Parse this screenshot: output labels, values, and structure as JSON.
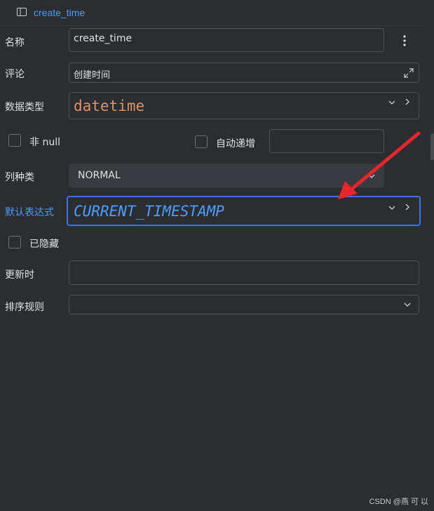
{
  "header": {
    "title": "create_time"
  },
  "labels": {
    "name": "名称",
    "comment": "评论",
    "data_type": "数据类型",
    "column_kind": "列种类",
    "default_expr": "默认表达式",
    "on_update": "更新时",
    "collation": "排序规则"
  },
  "fields": {
    "name_value": "create_time",
    "comment_value": "创建时间",
    "data_type_value": "datetime",
    "column_kind_value": "NORMAL",
    "default_expr_value": "CURRENT_TIMESTAMP",
    "auto_inc_value": "",
    "on_update_value": "",
    "collation_value": ""
  },
  "checkboxes": {
    "not_null": {
      "label": "非 null",
      "checked": false
    },
    "auto_increment": {
      "label": "自动递增",
      "checked": false
    },
    "hidden": {
      "label": "已隐藏",
      "checked": false
    }
  },
  "colors": {
    "background": "#2b2d30",
    "accent": "#4a9eff",
    "data_type_text": "#d7956d",
    "focus_border": "#3574f0",
    "annotation_arrow": "#e5262b"
  },
  "icons": {
    "header": "panel-icon",
    "more": "more-vertical-icon",
    "expand": "expand-icon",
    "dropdown": "chevron-down-icon",
    "next": "chevron-right-icon"
  },
  "watermark": "CSDN @燕 可 以"
}
